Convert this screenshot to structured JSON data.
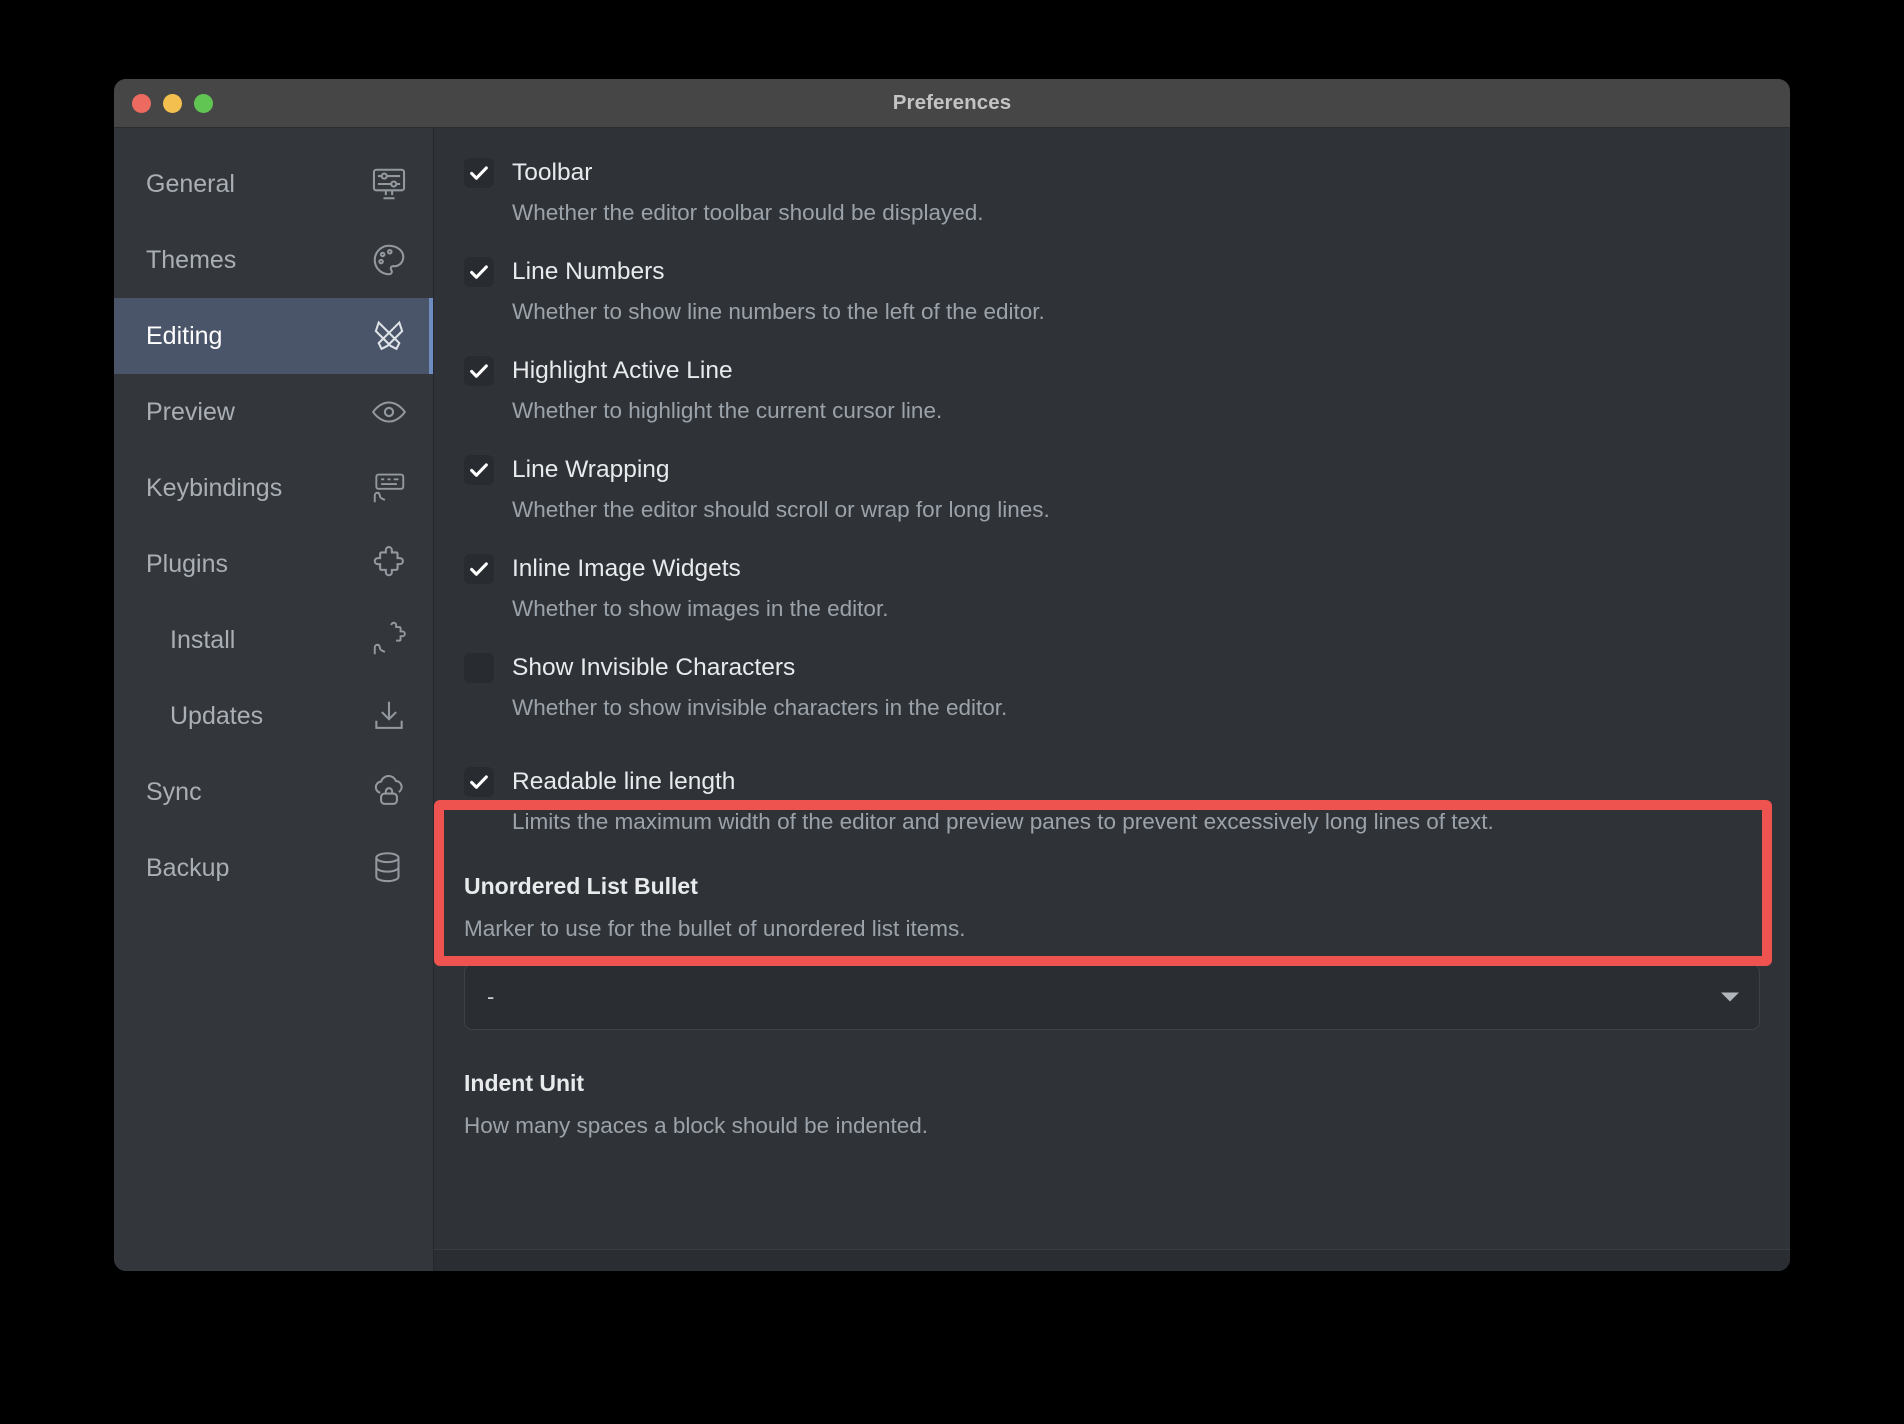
{
  "window": {
    "title": "Preferences",
    "controls": [
      "close-button",
      "minimize-button",
      "maximize-button"
    ]
  },
  "sidebar": {
    "items": [
      {
        "label": "General",
        "icon": "monitor-sliders-icon",
        "active": false,
        "sub": false
      },
      {
        "label": "Themes",
        "icon": "palette-icon",
        "active": false,
        "sub": false
      },
      {
        "label": "Editing",
        "icon": "crossed-pens-icon",
        "active": true,
        "sub": false
      },
      {
        "label": "Preview",
        "icon": "eye-icon",
        "active": false,
        "sub": false
      },
      {
        "label": "Keybindings",
        "icon": "keyboard-hand-icon",
        "active": false,
        "sub": false
      },
      {
        "label": "Plugins",
        "icon": "puzzle-piece-icon",
        "active": false,
        "sub": false
      },
      {
        "label": "Install",
        "icon": "puzzle-hand-icon",
        "active": false,
        "sub": true
      },
      {
        "label": "Updates",
        "icon": "download-icon",
        "active": false,
        "sub": true
      },
      {
        "label": "Sync",
        "icon": "cloud-lock-icon",
        "active": false,
        "sub": false
      },
      {
        "label": "Backup",
        "icon": "database-refresh-icon",
        "active": false,
        "sub": false
      }
    ]
  },
  "main": {
    "checkbox_settings": [
      {
        "title": "Toolbar",
        "desc": "Whether the editor toolbar should be displayed.",
        "checked": true
      },
      {
        "title": "Line Numbers",
        "desc": "Whether to show line numbers to the left of the editor.",
        "checked": true
      },
      {
        "title": "Highlight Active Line",
        "desc": "Whether to highlight the current cursor line.",
        "checked": true
      },
      {
        "title": "Line Wrapping",
        "desc": "Whether the editor should scroll or wrap for long lines.",
        "checked": true
      },
      {
        "title": "Inline Image Widgets",
        "desc": "Whether to show images in the editor.",
        "checked": true
      },
      {
        "title": "Show Invisible Characters",
        "desc": "Whether to show invisible characters in the editor.",
        "checked": false
      },
      {
        "title": "Readable line length",
        "desc": "Limits the maximum width of the editor and preview panes to prevent excessively long lines of text.",
        "checked": true
      }
    ],
    "unordered_list_bullet": {
      "label": "Unordered List Bullet",
      "desc": "Marker to use for the bullet of unordered list items.",
      "value": "-"
    },
    "indent_unit": {
      "label": "Indent Unit",
      "desc": "How many spaces a block should be indented."
    }
  },
  "annotation": {
    "highlight_color": "#ef5350",
    "target": "Readable line length"
  }
}
